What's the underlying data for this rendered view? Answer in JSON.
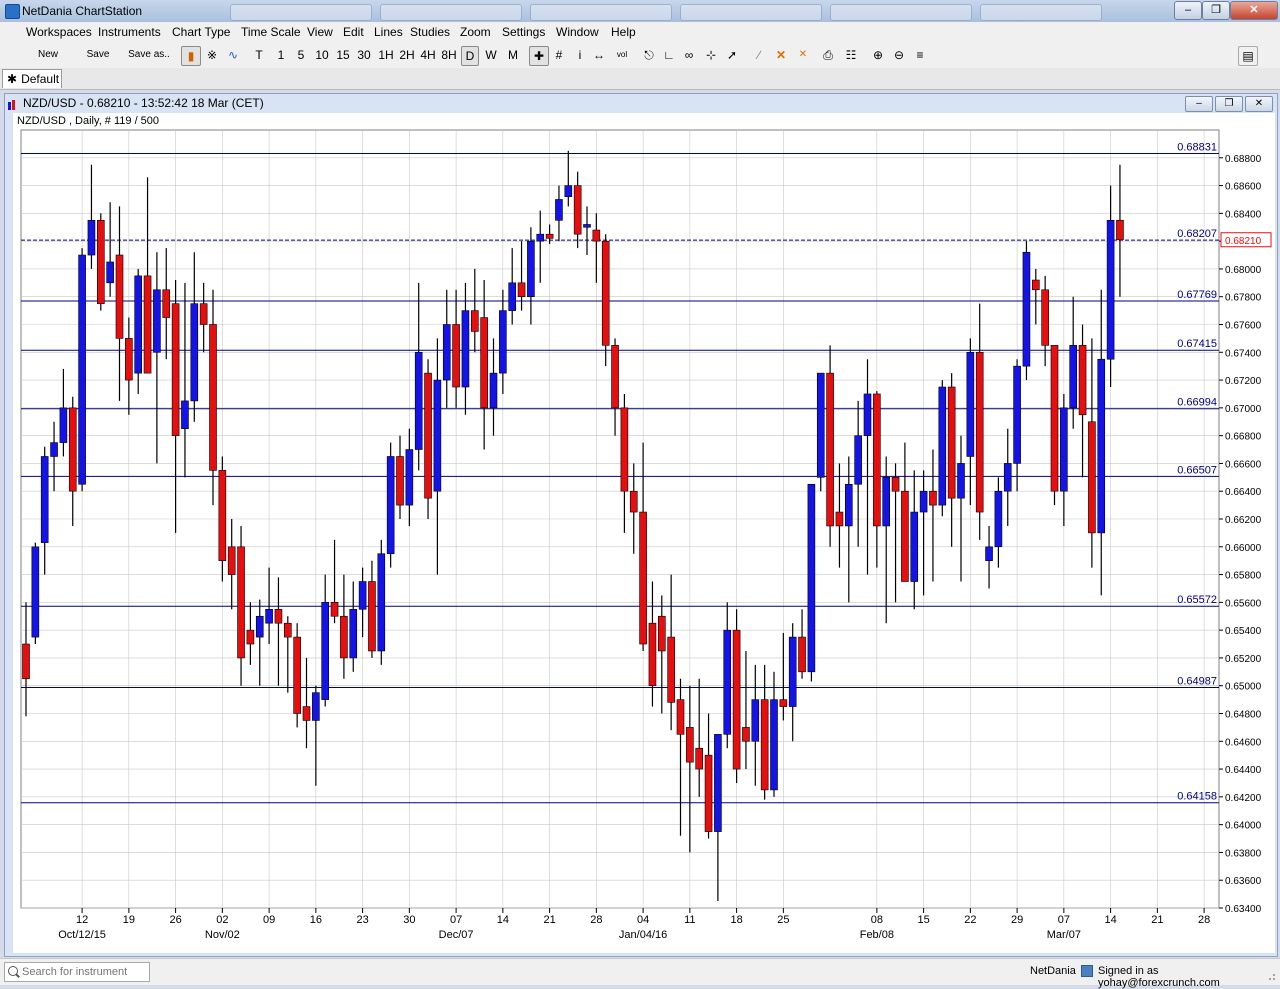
{
  "app": {
    "title": "NetDania ChartStation"
  },
  "menu": [
    "Workspaces",
    "Instruments",
    "Chart Type",
    "Time Scale",
    "View",
    "Edit",
    "Lines",
    "Studies",
    "Zoom",
    "Settings",
    "Window",
    "Help"
  ],
  "toolbar": {
    "new_label": "New",
    "save_label": "Save",
    "save_as_label": "Save as..",
    "timeframes": [
      "T",
      "1",
      "5",
      "10",
      "15",
      "30",
      "1H",
      "2H",
      "4H",
      "8H",
      "D",
      "W",
      "M"
    ],
    "selected_timeframe": "D",
    "extra": [
      "i",
      "vol"
    ]
  },
  "workspace_tab": {
    "label": "Default",
    "icon": "star-icon"
  },
  "chart_window": {
    "title": "NZD/USD - 0.68210 - 13:52:42  18 Mar (CET)",
    "subtitle": "NZD/USD , Daily, # 119 / 500"
  },
  "statusbar": {
    "search_placeholder": "Search for instrument",
    "brand": "NetDania",
    "user": "Signed in as yohay@forexcrunch.com"
  },
  "colors": {
    "bull": "#1414e6",
    "bear": "#e60f0f",
    "hline": "#000080",
    "grid": "#c8c8c8"
  },
  "chart_data": {
    "type": "candlestick",
    "symbol": "NZD/USD",
    "ylim": [
      0.634,
      0.69
    ],
    "y_ticks": [
      0.634,
      0.636,
      0.638,
      0.64,
      0.642,
      0.644,
      0.646,
      0.648,
      0.65,
      0.652,
      0.654,
      0.656,
      0.658,
      0.66,
      0.662,
      0.664,
      0.666,
      0.668,
      0.67,
      0.672,
      0.674,
      0.676,
      0.678,
      0.68,
      0.682,
      0.684,
      0.686,
      0.688
    ],
    "x_ticks": [
      {
        "i": 6,
        "label": "12",
        "sub": "Oct/12/15"
      },
      {
        "i": 11,
        "label": "19"
      },
      {
        "i": 16,
        "label": "26"
      },
      {
        "i": 21,
        "label": "02",
        "sub": "Nov/02"
      },
      {
        "i": 26,
        "label": "09"
      },
      {
        "i": 31,
        "label": "16"
      },
      {
        "i": 36,
        "label": "23"
      },
      {
        "i": 41,
        "label": "30"
      },
      {
        "i": 46,
        "label": "07",
        "sub": "Dec/07"
      },
      {
        "i": 51,
        "label": "14"
      },
      {
        "i": 56,
        "label": "21"
      },
      {
        "i": 61,
        "label": "28"
      },
      {
        "i": 66,
        "label": "04",
        "sub": "Jan/04/16"
      },
      {
        "i": 71,
        "label": "11"
      },
      {
        "i": 76,
        "label": "18"
      },
      {
        "i": 81,
        "label": "25"
      },
      {
        "i": 91,
        "label": "08",
        "sub": "Feb/08"
      },
      {
        "i": 96,
        "label": "15"
      },
      {
        "i": 101,
        "label": "22"
      },
      {
        "i": 106,
        "label": "29"
      },
      {
        "i": 111,
        "label": "07",
        "sub": "Mar/07"
      },
      {
        "i": 116,
        "label": "14"
      },
      {
        "i": 121,
        "label": "21"
      },
      {
        "i": 126,
        "label": "28"
      }
    ],
    "hlines": [
      {
        "value": 0.68831,
        "label": "0.68831"
      },
      {
        "value": 0.68207,
        "label": "0.68207"
      },
      {
        "value": 0.67769,
        "label": "0.67769"
      },
      {
        "value": 0.67415,
        "label": "0.67415"
      },
      {
        "value": 0.66994,
        "label": "0.66994"
      },
      {
        "value": 0.66507,
        "label": "0.66507"
      },
      {
        "value": 0.65572,
        "label": "0.65572"
      },
      {
        "value": 0.64987,
        "label": "0.64987"
      },
      {
        "value": 0.64158,
        "label": "0.64158"
      }
    ],
    "last_price": {
      "value": 0.6821,
      "label": "0.68210"
    },
    "candles": [
      [
        0,
        0.653,
        0.656,
        0.6478,
        0.6505
      ],
      [
        1,
        0.6535,
        0.6603,
        0.653,
        0.66
      ],
      [
        2,
        0.6603,
        0.6672,
        0.658,
        0.6665
      ],
      [
        3,
        0.6665,
        0.669,
        0.664,
        0.6675
      ],
      [
        4,
        0.6675,
        0.6728,
        0.6665,
        0.67
      ],
      [
        5,
        0.67,
        0.6708,
        0.6615,
        0.664
      ],
      [
        6,
        0.6645,
        0.6815,
        0.664,
        0.681
      ],
      [
        7,
        0.681,
        0.6875,
        0.68,
        0.6835
      ],
      [
        8,
        0.6835,
        0.684,
        0.677,
        0.6775
      ],
      [
        9,
        0.679,
        0.6848,
        0.678,
        0.6805
      ],
      [
        10,
        0.681,
        0.6845,
        0.6705,
        0.675
      ],
      [
        11,
        0.675,
        0.6765,
        0.6695,
        0.672
      ],
      [
        12,
        0.6725,
        0.68,
        0.671,
        0.6795
      ],
      [
        13,
        0.6795,
        0.6866,
        0.6725,
        0.6725
      ],
      [
        14,
        0.674,
        0.6812,
        0.666,
        0.6785
      ],
      [
        15,
        0.6785,
        0.6815,
        0.6735,
        0.6765
      ],
      [
        16,
        0.6775,
        0.6792,
        0.661,
        0.668
      ],
      [
        17,
        0.6685,
        0.679,
        0.665,
        0.6705
      ],
      [
        18,
        0.6705,
        0.6812,
        0.669,
        0.6775
      ],
      [
        19,
        0.6775,
        0.679,
        0.674,
        0.676
      ],
      [
        20,
        0.676,
        0.6785,
        0.663,
        0.6655
      ],
      [
        21,
        0.6655,
        0.6665,
        0.6575,
        0.659
      ],
      [
        22,
        0.66,
        0.662,
        0.6555,
        0.658
      ],
      [
        23,
        0.66,
        0.6615,
        0.65,
        0.652
      ],
      [
        24,
        0.654,
        0.656,
        0.6515,
        0.653
      ],
      [
        25,
        0.6535,
        0.6562,
        0.65,
        0.655
      ],
      [
        26,
        0.6545,
        0.6585,
        0.653,
        0.6555
      ],
      [
        27,
        0.6555,
        0.6578,
        0.65,
        0.6545
      ],
      [
        28,
        0.6545,
        0.655,
        0.6495,
        0.6535
      ],
      [
        29,
        0.6535,
        0.6545,
        0.647,
        0.648
      ],
      [
        30,
        0.6485,
        0.652,
        0.6455,
        0.6475
      ],
      [
        31,
        0.6475,
        0.65,
        0.6428,
        0.6495
      ],
      [
        32,
        0.649,
        0.658,
        0.6485,
        0.656
      ],
      [
        33,
        0.656,
        0.6605,
        0.6545,
        0.655
      ],
      [
        34,
        0.655,
        0.658,
        0.6505,
        0.652
      ],
      [
        35,
        0.652,
        0.6575,
        0.651,
        0.6555
      ],
      [
        36,
        0.6555,
        0.6585,
        0.6535,
        0.6575
      ],
      [
        37,
        0.6575,
        0.659,
        0.652,
        0.6525
      ],
      [
        38,
        0.6525,
        0.6605,
        0.6515,
        0.6595
      ],
      [
        39,
        0.6595,
        0.6675,
        0.6585,
        0.6665
      ],
      [
        40,
        0.6665,
        0.668,
        0.662,
        0.663
      ],
      [
        41,
        0.663,
        0.6685,
        0.6615,
        0.667
      ],
      [
        42,
        0.667,
        0.679,
        0.6655,
        0.674
      ],
      [
        43,
        0.6725,
        0.6735,
        0.662,
        0.6635
      ],
      [
        44,
        0.664,
        0.675,
        0.658,
        0.672
      ],
      [
        45,
        0.672,
        0.6785,
        0.67,
        0.676
      ],
      [
        46,
        0.676,
        0.6785,
        0.67,
        0.6715
      ],
      [
        47,
        0.6715,
        0.679,
        0.6695,
        0.677
      ],
      [
        48,
        0.677,
        0.68,
        0.674,
        0.6755
      ],
      [
        49,
        0.6765,
        0.6792,
        0.667,
        0.67
      ],
      [
        50,
        0.67,
        0.675,
        0.668,
        0.6725
      ],
      [
        51,
        0.6725,
        0.6785,
        0.671,
        0.677
      ],
      [
        52,
        0.677,
        0.6815,
        0.676,
        0.679
      ],
      [
        53,
        0.679,
        0.682,
        0.677,
        0.678
      ],
      [
        54,
        0.678,
        0.683,
        0.676,
        0.682
      ],
      [
        55,
        0.682,
        0.6842,
        0.679,
        0.6825
      ],
      [
        56,
        0.6825,
        0.6832,
        0.6818,
        0.6822
      ],
      [
        57,
        0.6835,
        0.686,
        0.682,
        0.685
      ],
      [
        58,
        0.6852,
        0.6885,
        0.6845,
        0.686
      ],
      [
        59,
        0.686,
        0.687,
        0.6815,
        0.6825
      ],
      [
        60,
        0.683,
        0.6845,
        0.681,
        0.6832
      ],
      [
        61,
        0.6828,
        0.684,
        0.679,
        0.682
      ],
      [
        62,
        0.682,
        0.6825,
        0.673,
        0.6745
      ],
      [
        63,
        0.6745,
        0.675,
        0.668,
        0.67
      ],
      [
        64,
        0.67,
        0.671,
        0.661,
        0.664
      ],
      [
        65,
        0.664,
        0.666,
        0.6595,
        0.6625
      ],
      [
        66,
        0.6625,
        0.6675,
        0.6525,
        0.653
      ],
      [
        67,
        0.6545,
        0.6575,
        0.6485,
        0.65
      ],
      [
        68,
        0.655,
        0.6565,
        0.648,
        0.6525
      ],
      [
        69,
        0.6535,
        0.658,
        0.6468,
        0.6488
      ],
      [
        70,
        0.649,
        0.6505,
        0.6392,
        0.6465
      ],
      [
        71,
        0.647,
        0.65,
        0.638,
        0.6445
      ],
      [
        72,
        0.6455,
        0.6505,
        0.642,
        0.644
      ],
      [
        73,
        0.645,
        0.648,
        0.639,
        0.6395
      ],
      [
        74,
        0.6395,
        0.6458,
        0.6345,
        0.6465
      ],
      [
        75,
        0.6465,
        0.656,
        0.6455,
        0.654
      ],
      [
        76,
        0.654,
        0.6555,
        0.643,
        0.644
      ],
      [
        77,
        0.647,
        0.6525,
        0.644,
        0.646
      ],
      [
        78,
        0.646,
        0.6515,
        0.6428,
        0.649
      ],
      [
        79,
        0.649,
        0.6515,
        0.6418,
        0.6425
      ],
      [
        80,
        0.6425,
        0.651,
        0.642,
        0.649
      ],
      [
        81,
        0.649,
        0.6538,
        0.6475,
        0.6485
      ],
      [
        82,
        0.6485,
        0.6545,
        0.646,
        0.6535
      ],
      [
        83,
        0.6535,
        0.6555,
        0.6505,
        0.651
      ],
      [
        84,
        0.651,
        0.6645,
        0.6503,
        0.6645
      ],
      [
        85,
        0.665,
        0.6708,
        0.664,
        0.6725
      ],
      [
        86,
        0.6725,
        0.6745,
        0.66,
        0.6615
      ],
      [
        87,
        0.6625,
        0.666,
        0.6585,
        0.6615
      ],
      [
        88,
        0.6615,
        0.6665,
        0.656,
        0.6645
      ],
      [
        89,
        0.6645,
        0.6705,
        0.66,
        0.668
      ],
      [
        90,
        0.668,
        0.6735,
        0.658,
        0.671
      ],
      [
        91,
        0.671,
        0.6712,
        0.6585,
        0.6615
      ],
      [
        92,
        0.6615,
        0.6665,
        0.6545,
        0.665
      ],
      [
        93,
        0.665,
        0.666,
        0.656,
        0.664
      ],
      [
        94,
        0.664,
        0.6675,
        0.659,
        0.6575
      ],
      [
        95,
        0.6575,
        0.6655,
        0.6555,
        0.6625
      ],
      [
        96,
        0.6625,
        0.6655,
        0.6565,
        0.664
      ],
      [
        97,
        0.664,
        0.667,
        0.6575,
        0.663
      ],
      [
        98,
        0.663,
        0.672,
        0.6622,
        0.6715
      ],
      [
        99,
        0.6715,
        0.6725,
        0.66,
        0.6635
      ],
      [
        100,
        0.6635,
        0.668,
        0.6575,
        0.666
      ],
      [
        101,
        0.6665,
        0.675,
        0.663,
        0.674
      ],
      [
        102,
        0.674,
        0.6775,
        0.6605,
        0.6625
      ],
      [
        103,
        0.659,
        0.6615,
        0.657,
        0.66
      ],
      [
        104,
        0.66,
        0.665,
        0.6585,
        0.664
      ],
      [
        105,
        0.664,
        0.6685,
        0.6615,
        0.666
      ],
      [
        106,
        0.666,
        0.6735,
        0.664,
        0.673
      ],
      [
        107,
        0.673,
        0.682,
        0.672,
        0.6812
      ],
      [
        108,
        0.6792,
        0.68,
        0.676,
        0.6785
      ],
      [
        109,
        0.6785,
        0.6795,
        0.673,
        0.6745
      ],
      [
        110,
        0.6745,
        0.6745,
        0.663,
        0.664
      ],
      [
        111,
        0.664,
        0.671,
        0.6615,
        0.67
      ],
      [
        112,
        0.67,
        0.678,
        0.6685,
        0.6745
      ],
      [
        113,
        0.6745,
        0.676,
        0.665,
        0.6695
      ],
      [
        114,
        0.669,
        0.675,
        0.6585,
        0.661
      ],
      [
        115,
        0.661,
        0.6785,
        0.6565,
        0.6735
      ],
      [
        116,
        0.6735,
        0.686,
        0.6715,
        0.6835
      ],
      [
        117,
        0.6835,
        0.6875,
        0.678,
        0.6821
      ]
    ]
  }
}
